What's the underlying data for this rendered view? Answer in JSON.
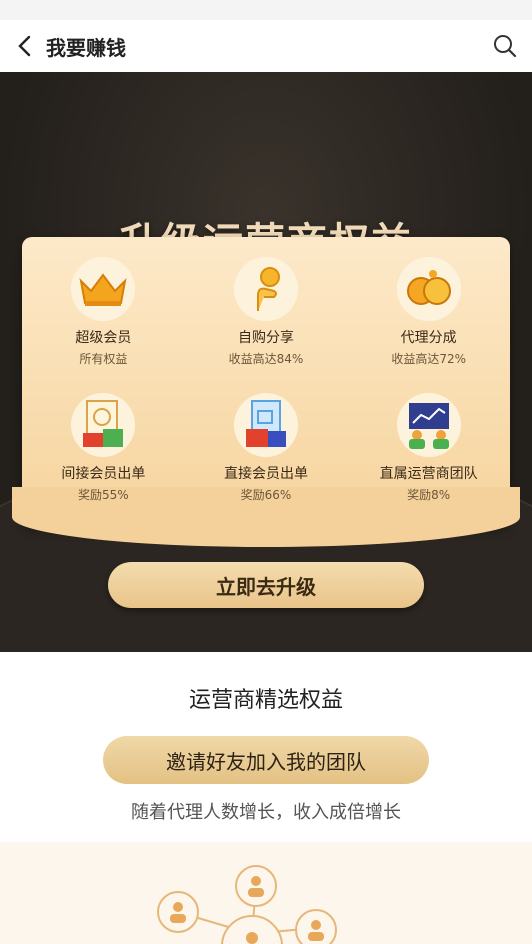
{
  "nav": {
    "title": "我要赚钱",
    "back_icon": "chevron-left-icon",
    "search_icon": "search-icon"
  },
  "hero": {
    "title": "升级运营商权益",
    "benefits": [
      {
        "name": "超级会员",
        "sub": "所有权益",
        "icon": "crown-icon"
      },
      {
        "name": "自购分享",
        "sub": "收益高达84%",
        "icon": "hand-coin-icon"
      },
      {
        "name": "代理分成",
        "sub": "收益高达72%",
        "icon": "coins-icon"
      },
      {
        "name": "间接会员出单",
        "sub": "奖励55%",
        "icon": "gift-indirect-icon"
      },
      {
        "name": "直接会员出单",
        "sub": "奖励66%",
        "icon": "gift-direct-icon"
      },
      {
        "name": "直属运营商团队",
        "sub": "奖励8%",
        "icon": "team-chart-icon"
      }
    ],
    "upgrade_label": "立即去升级"
  },
  "section": {
    "title": "运营商精选权益",
    "invite_label": "邀请好友加入我的团队",
    "invite_sub": "随着代理人数增长，收入成倍增长"
  },
  "colors": {
    "dark_bg": "#2a2520",
    "gold_text": "#f0d9b8",
    "card": "#f6d49d",
    "button": "#e9c48a"
  }
}
